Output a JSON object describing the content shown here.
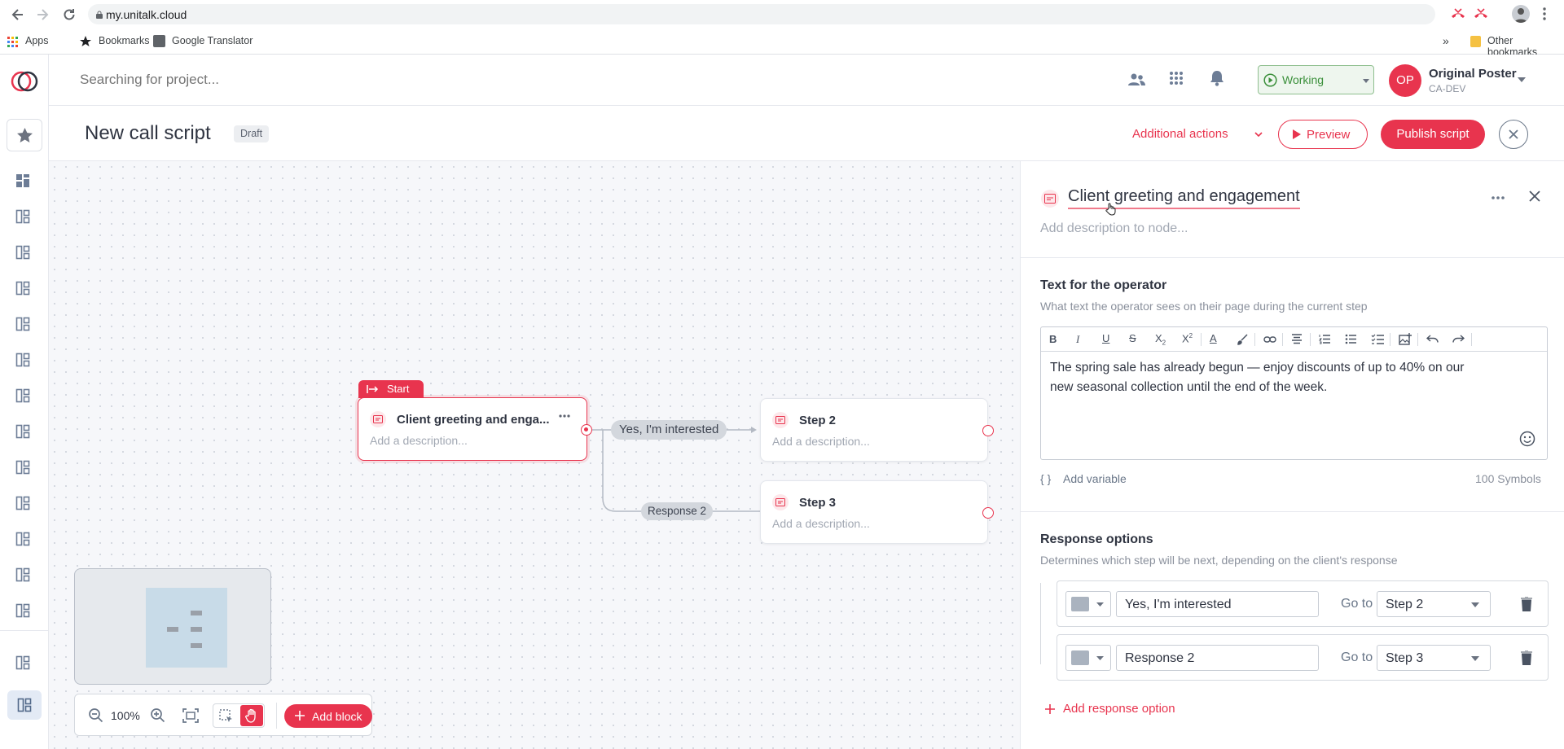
{
  "browser": {
    "url": "my.unitalk.cloud",
    "bookmarks": {
      "apps": "Apps",
      "bookmarks": "Bookmarks",
      "translator": "Google Translator",
      "other": "Other bookmarks",
      "more": "»"
    }
  },
  "header": {
    "search_placeholder": "Searching for project...",
    "status": "Working",
    "user": {
      "initials": "OP",
      "name": "Original Poster",
      "org": "CA-DEV"
    }
  },
  "script": {
    "title": "New call script",
    "badge": "Draft",
    "additional_actions": "Additional actions",
    "preview": "Preview",
    "publish": "Publish script"
  },
  "canvas": {
    "start_label": "Start",
    "nodes": [
      {
        "title": "Client greeting and enga...",
        "desc": "Add a description..."
      },
      {
        "title": "Step 2",
        "desc": "Add a description..."
      },
      {
        "title": "Step 3",
        "desc": "Add a description..."
      }
    ],
    "edges": [
      "Yes, I'm interested",
      "Response 2"
    ],
    "zoom": "100%",
    "add_block": "Add block"
  },
  "panel": {
    "node_title": "Client greeting and engagement",
    "desc_placeholder": "Add description to node...",
    "operator_heading": "Text for the operator",
    "operator_sub": "What text the operator sees on their page during the current step",
    "editor_text_1": "The spring sale has already begun — enjoy discounts of up to 40% on our",
    "editor_text_2": "new seasonal collection until the end of the week.",
    "add_variable": "Add variable",
    "symbols": "100 Symbols",
    "responses_heading": "Response options",
    "responses_sub": "Determines which step will be next, depending on the client's response",
    "goto": "Go to",
    "responses": [
      {
        "text": "Yes, I'm interested",
        "target": "Step 2"
      },
      {
        "text": "Response 2",
        "target": "Step 3"
      }
    ],
    "add_response": "Add response option"
  },
  "colors": {
    "accent": "#e8344e",
    "working": "#3a8f3a",
    "text": "#2f3441",
    "muted": "#8a909c"
  }
}
